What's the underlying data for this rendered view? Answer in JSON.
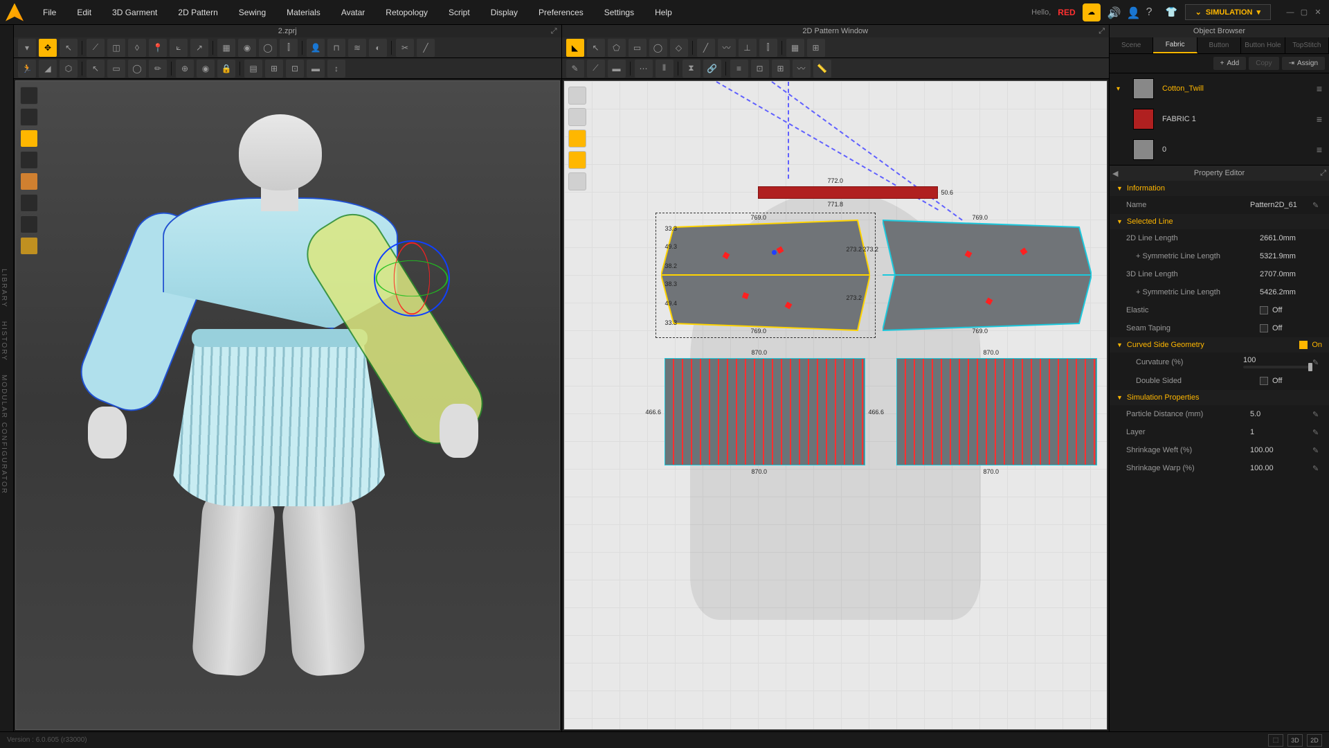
{
  "menu": [
    "File",
    "Edit",
    "3D Garment",
    "2D Pattern",
    "Sewing",
    "Materials",
    "Avatar",
    "Retopology",
    "Script",
    "Display",
    "Preferences",
    "Settings",
    "Help"
  ],
  "hello": "Hello,",
  "user": "RED",
  "sim_button": "SIMULATION",
  "viewport3d_title": "2.zprj",
  "viewport2d_title": "2D Pattern Window",
  "object_browser_title": "Object Browser",
  "tabs": [
    "Scene",
    "Fabric",
    "Button",
    "Button Hole",
    "TopStitch"
  ],
  "active_tab": 1,
  "actions": {
    "add": "Add",
    "copy": "Copy",
    "assign": "Assign"
  },
  "fabrics": [
    {
      "name": "Cotton_Twill",
      "color": "#888888",
      "accent": true,
      "chev": true
    },
    {
      "name": "FABRIC 1",
      "color": "#b02020",
      "accent": false,
      "chev": false
    },
    {
      "name": "0",
      "color": "#888888",
      "accent": false,
      "chev": false
    }
  ],
  "property_editor_title": "Property Editor",
  "sections": {
    "information": {
      "title": "Information",
      "name_label": "Name",
      "name_value": "Pattern2D_61"
    },
    "selected_line": {
      "title": "Selected Line",
      "rows": [
        {
          "label": "2D Line Length",
          "value": "2661.0mm"
        },
        {
          "label": "+ Symmetric Line Length",
          "value": "5321.9mm",
          "sub": true
        },
        {
          "label": "3D Line Length",
          "value": "2707.0mm"
        },
        {
          "label": "+ Symmetric Line Length",
          "value": "5426.2mm",
          "sub": true
        }
      ],
      "elastic_label": "Elastic",
      "elastic_state": "Off",
      "seam_label": "Seam Taping",
      "seam_state": "Off"
    },
    "curved": {
      "title": "Curved Side Geometry",
      "state": "On",
      "curvature_label": "Curvature (%)",
      "curvature_value": "100",
      "double_label": "Double Sided",
      "double_state": "Off"
    },
    "sim_props": {
      "title": "Simulation Properties",
      "rows": [
        {
          "label": "Particle Distance (mm)",
          "value": "5.0"
        },
        {
          "label": "Layer",
          "value": "1"
        },
        {
          "label": "Shrinkage Weft (%)",
          "value": "100.00"
        },
        {
          "label": "Shrinkage Warp (%)",
          "value": "100.00"
        }
      ]
    }
  },
  "dims": {
    "top_w": "772.0",
    "top_w2": "771.8",
    "top_h": "50.6",
    "sl_top": "769.0",
    "sl_bot": "769.0",
    "sl_side_a": "33.3",
    "sl_side_b": "49.3",
    "sl_side_c": "38.2",
    "sl_side_d": "49.4",
    "sl_side_e": "33.3",
    "sl_side_f": "38.3",
    "sl_r": "273.2",
    "sl2_top": "769.0",
    "sl2_bot": "769.0",
    "sl2_r": "273.2",
    "sk_top": "870.0",
    "sk_bot": "870.0",
    "sk_side": "466.6",
    "sk2_top": "870.0",
    "sk2_bot": "870.0"
  },
  "status_version": "Version : 6.0.605 (r33000)",
  "status_views": [
    "⬚",
    "3D",
    "2D"
  ],
  "side_labels": {
    "lib": "LIBRARY",
    "hist": "HISTORY",
    "mod": "MODULAR CONFIGURATOR"
  }
}
